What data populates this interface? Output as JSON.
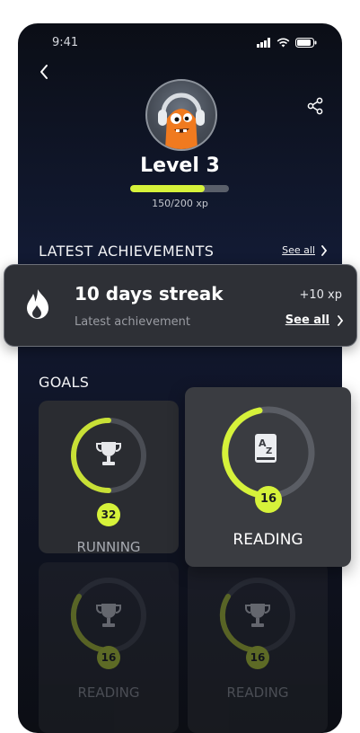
{
  "status": {
    "time": "9:41"
  },
  "profile": {
    "level_label": "Level 3",
    "xp_text": "150/200 xp",
    "xp_progress": 0.75
  },
  "latest": {
    "title": "LATEST ACHIEVEMENTS",
    "see_all": "See all"
  },
  "streak_card": {
    "title": "10 days streak",
    "subtitle": "Latest achievement",
    "xp": "+10 xp",
    "see_all": "See all"
  },
  "goals": {
    "title": "GOALS",
    "items": [
      {
        "label": "RUNNING",
        "count": "32",
        "icon": "trophy-icon",
        "progress": 0.6
      },
      {
        "label": "READING",
        "count": "16",
        "icon": "book-az-icon",
        "progress": 0.4
      },
      {
        "label": "READING",
        "count": "16",
        "icon": "trophy-icon",
        "progress": 0.4
      },
      {
        "label": "READING",
        "count": "16",
        "icon": "trophy-icon",
        "progress": 0.4
      }
    ]
  },
  "colors": {
    "accent": "#d6f23a",
    "card": "#2a2c31",
    "background": "#0b0e16"
  }
}
